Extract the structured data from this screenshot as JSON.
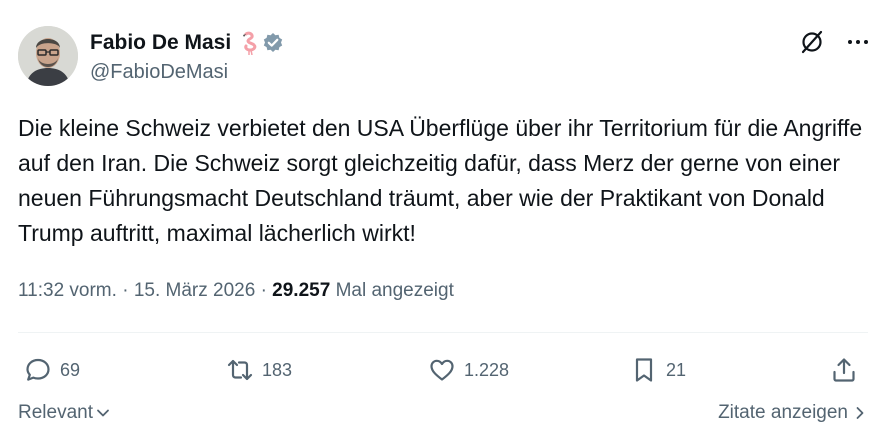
{
  "author": {
    "display_name": "Fabio De Masi",
    "handle": "@FabioDeMasi",
    "flamingo_emoji": "flamingo-icon",
    "verified_badge": "verified-badge-icon"
  },
  "tweet": {
    "text": "Die kleine Schweiz verbietet den USA Überflüge über ihr Territorium für die Angriffe  auf den Iran. Die Schweiz sorgt gleichzeitig dafür, dass Merz der gerne von einer neuen Führungsmacht Deutschland träumt, aber wie der Praktikant von Donald Trump auftritt, maximal lächerlich wirkt!"
  },
  "meta": {
    "time": "11:32 vorm.",
    "separator": "·",
    "date": "15. März 2026",
    "views_count": "29.257",
    "views_label": "Mal angezeigt"
  },
  "actions": {
    "reply_count": "69",
    "repost_count": "183",
    "like_count": "1.228",
    "bookmark_count": "21"
  },
  "footer": {
    "sort_label": "Relevant",
    "quotes_label": "Zitate anzeigen"
  },
  "colors": {
    "text_primary": "#0f1419",
    "text_secondary": "#536471",
    "verified_gray": "#829aab",
    "flamingo_pink": "#f4a0a8",
    "divider": "#eff3f4"
  }
}
